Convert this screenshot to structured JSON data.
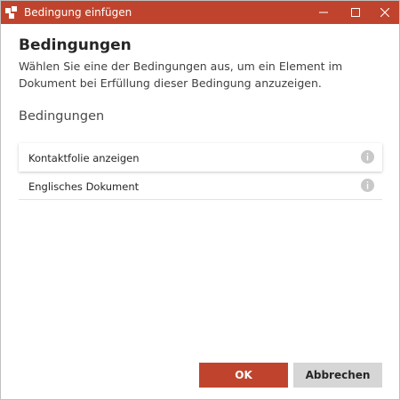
{
  "window": {
    "title": "Bedingung einfügen",
    "app_icon": "app-logo-icon",
    "controls": [
      "minimize-icon",
      "maximize-icon",
      "close-icon"
    ]
  },
  "dialog": {
    "heading": "Bedingungen",
    "description": "Wählen Sie eine der Bedingungen aus, um ein Element im Dokument bei Erfüllung dieser Bedingung anzuzeigen.",
    "section_title": "Bedingungen",
    "conditions": [
      {
        "label": "Kontaktfolie anzeigen",
        "selected": true,
        "icon": "info-icon"
      },
      {
        "label": "Englisches Dokument",
        "selected": false,
        "icon": "info-icon"
      }
    ]
  },
  "buttons": {
    "ok_label": "OK",
    "cancel_label": "Abbrechen"
  },
  "colors": {
    "accent": "#c0442d",
    "secondary_button": "#d6d6d6",
    "info_icon": "#c8c8c8"
  }
}
